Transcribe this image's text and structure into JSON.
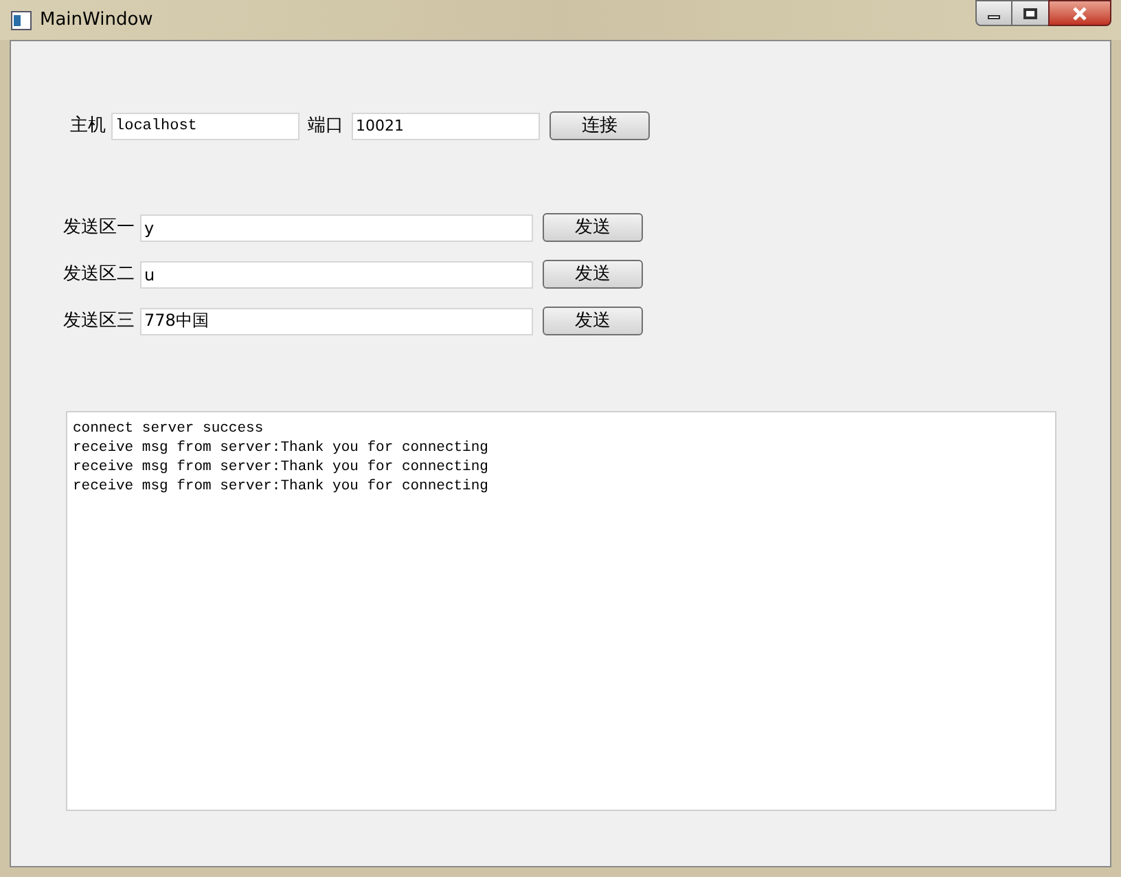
{
  "window": {
    "title": "MainWindow"
  },
  "connection": {
    "host_label": "主机",
    "host": "localhost",
    "port_label": "端口",
    "port": "10021",
    "button": "连接"
  },
  "send_rows": [
    {
      "label": "发送区一",
      "value": "y",
      "button": "发送"
    },
    {
      "label": "发送区二",
      "value": "u",
      "button": "发送"
    },
    {
      "label": "发送区三",
      "value": "778中国",
      "button": "发送"
    }
  ],
  "log": [
    "connect server success",
    "receive msg from server:Thank you for connecting",
    "receive msg from server:Thank you for connecting",
    "receive msg from server:Thank you for connecting"
  ]
}
